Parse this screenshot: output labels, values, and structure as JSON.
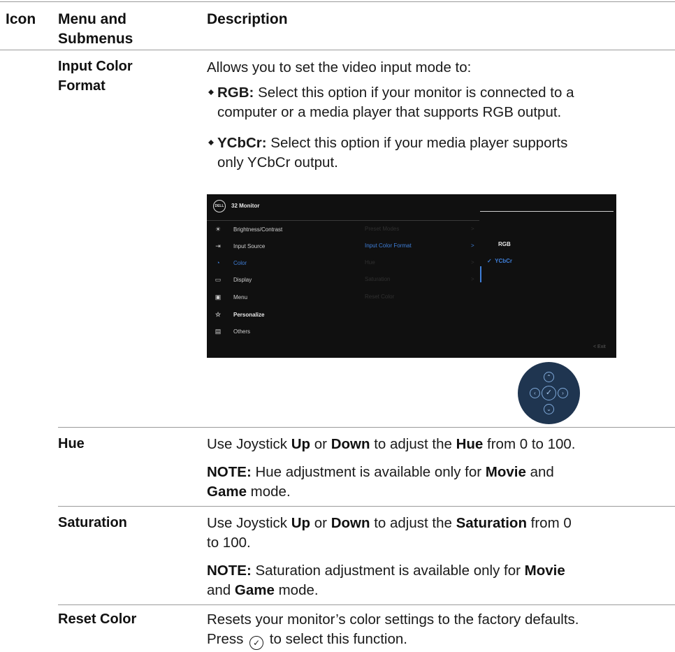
{
  "header": {
    "icon_col": "Icon",
    "menu_col_line1": "Menu and",
    "menu_col_line2": "Submenus",
    "desc_col": "Description"
  },
  "rows": {
    "input_color_format": {
      "menu_line1": "Input Color",
      "menu_line2": "Format",
      "intro": "Allows you to set the video input mode to:",
      "rgb_label": "RGB:",
      "rgb_text_line1": " Select this option if your monitor is connected to a",
      "rgb_text_line2": "computer or a media player that supports RGB output.",
      "ycbcr_label": "YCbCr:",
      "ycbcr_text_line1": " Select this option if your media player supports",
      "ycbcr_text_line2": "only YCbCr output."
    },
    "hue": {
      "menu": "Hue",
      "line1": [
        "Use Joystick ",
        "Up",
        " or ",
        "Down",
        " to adjust the ",
        "Hue",
        " from 0 to 100."
      ],
      "note_label": "NOTE:",
      "note_line1": " Hue adjustment is available only for ",
      "note_movie": "Movie",
      "note_and": " and",
      "note_game": "Game",
      "note_mode": " mode."
    },
    "saturation": {
      "menu": "Saturation",
      "line1": [
        "Use Joystick ",
        "Up",
        " or ",
        "Down",
        " to adjust the ",
        "Saturation",
        " from 0"
      ],
      "line2": "to 100.",
      "note_label": "NOTE:",
      "note_line1": " Saturation adjustment is available only for ",
      "note_movie": "Movie",
      "note_and": "and ",
      "note_game": "Game",
      "note_mode": " mode."
    },
    "reset_color": {
      "menu": "Reset Color",
      "line1": "Resets your monitor’s color settings to the factory defaults.",
      "press": "Press",
      "press_after": " to select this function."
    }
  },
  "osd": {
    "logo": "DELL",
    "title": "32 Monitor",
    "menu_items": [
      {
        "icon": "☀",
        "label": "Brightness/Contrast"
      },
      {
        "icon": "⇥",
        "label": "Input Source"
      },
      {
        "icon": "◔",
        "label": "Color"
      },
      {
        "icon": "▭",
        "label": "Display"
      },
      {
        "icon": "▣",
        "label": "Menu"
      },
      {
        "icon": "☆",
        "label": "Personalize"
      },
      {
        "icon": "▤",
        "label": "Others"
      }
    ],
    "submenu_items": [
      "Preset Modes",
      "Input Color Format",
      "Hue",
      "Saturation",
      "Reset Color"
    ],
    "options": [
      "RGB",
      "YCbCr"
    ],
    "selected_check": "✓",
    "exit": "< Exit"
  },
  "colors": {
    "osd_bg": "#101010",
    "osd_accent": "#3f7fd9",
    "joystick_bg": "#1f3550"
  }
}
